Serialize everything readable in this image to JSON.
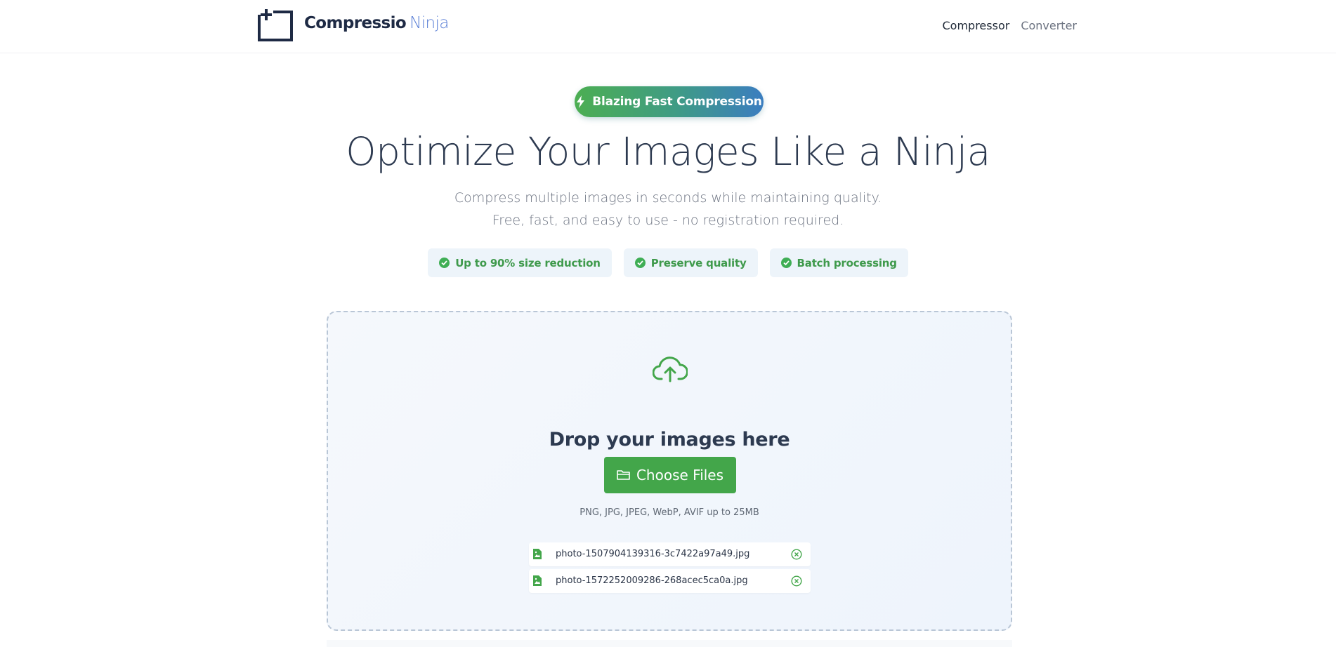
{
  "header": {
    "logo_bold": "Compressio",
    "logo_light": "Ninja",
    "nav": [
      {
        "label": "Compressor",
        "active": true
      },
      {
        "label": "Converter",
        "active": false
      }
    ]
  },
  "hero": {
    "badge": "Blazing Fast Compression",
    "title": "Optimize Your Images Like a Ninja",
    "subtitle_line1": "Compress multiple images in seconds while maintaining quality.",
    "subtitle_line2": "Free, fast, and easy to use - no registration required.",
    "features": [
      {
        "label": "Up to 90% size reduction"
      },
      {
        "label": "Preserve quality"
      },
      {
        "label": "Batch processing"
      }
    ]
  },
  "dropzone": {
    "title": "Drop your images here",
    "button_label": "Choose Files",
    "formats": "PNG, JPG, JPEG, WebP, AVIF up to 25MB",
    "files": [
      {
        "name": "photo-1507904139316-3c7422a97a49.jpg"
      },
      {
        "name": "photo-1572252009286-268acec5ca0a.jpg"
      }
    ]
  },
  "colors": {
    "accent_green": "#43a64a",
    "brand_dark": "#1e2a44",
    "brand_blue": "#5a7fd6",
    "badge_gradient_start": "#4cae52",
    "badge_gradient_end": "#3b7dc0"
  },
  "icons": {
    "logo": "plus-frame-logo-icon",
    "badge": "lightning-bolt-icon",
    "feature": "check-circle-icon",
    "upload": "cloud-upload-icon",
    "button": "folder-icon",
    "file": "image-file-icon",
    "remove": "close-circle-icon"
  }
}
